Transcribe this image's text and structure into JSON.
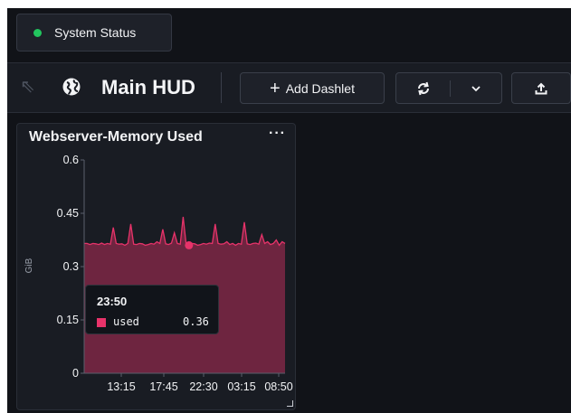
{
  "status": {
    "label": "System Status",
    "dot_color": "#22c55e"
  },
  "toolbar": {
    "title": "Main HUD",
    "add_label": "Add Dashlet",
    "back_icon": "arrow-up-left-icon",
    "globe_icon": "globe-icon",
    "refresh_icon": "refresh-icon",
    "chevron_icon": "chevron-down-icon",
    "upload_icon": "upload-icon"
  },
  "panel": {
    "title": "Webserver-Memory Used",
    "menu_label": "···",
    "tooltip": {
      "time": "23:50",
      "series": "used",
      "value": "0.36"
    }
  },
  "chart_data": {
    "type": "area",
    "title": "Webserver-Memory Used",
    "xlabel": "",
    "ylabel": "GiB",
    "yticks": [
      "0",
      "0.15",
      "0.3",
      "0.45",
      "0.6"
    ],
    "ylim": [
      0,
      0.6
    ],
    "xticks": [
      "13:15",
      "17:45",
      "22:30",
      "03:15",
      "08:50"
    ],
    "series": [
      {
        "name": "used",
        "color": "#e8336a",
        "values": [
          0.365,
          0.365,
          0.362,
          0.365,
          0.364,
          0.362,
          0.366,
          0.362,
          0.365,
          0.363,
          0.41,
          0.365,
          0.363,
          0.364,
          0.36,
          0.365,
          0.42,
          0.363,
          0.362,
          0.365,
          0.364,
          0.36,
          0.362,
          0.365,
          0.363,
          0.37,
          0.365,
          0.405,
          0.364,
          0.362,
          0.366,
          0.395,
          0.365,
          0.363,
          0.44,
          0.365,
          0.362,
          0.365,
          0.364,
          0.36,
          0.362,
          0.365,
          0.363,
          0.366,
          0.365,
          0.42,
          0.365,
          0.363,
          0.364,
          0.37,
          0.362,
          0.365,
          0.36,
          0.365,
          0.363,
          0.425,
          0.364,
          0.362,
          0.365,
          0.366,
          0.363,
          0.39,
          0.365,
          0.37,
          0.362,
          0.365,
          0.375,
          0.36,
          0.37,
          0.365
        ]
      }
    ],
    "highlight": {
      "index": 36,
      "value": 0.36
    },
    "grid": false
  }
}
